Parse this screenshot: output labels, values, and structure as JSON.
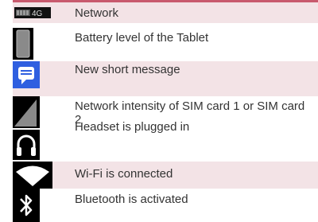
{
  "rows": [
    {
      "icon": "network-4g-icon",
      "description": "Network"
    },
    {
      "icon": "battery-icon",
      "description": "Battery level of the Tablet"
    },
    {
      "icon": "message-icon",
      "description": "New short message"
    },
    {
      "icon": "signal-strength-icon",
      "description": "Network intensity of SIM card 1 or SIM card 2"
    },
    {
      "icon": "headset-icon",
      "description": "Headset is plugged in"
    },
    {
      "icon": "wifi-icon",
      "description": "Wi-Fi is connected"
    },
    {
      "icon": "bluetooth-icon",
      "description": "Bluetooth is activated"
    }
  ],
  "colors": {
    "accent_rule": "#c85a6e",
    "row_shade": "#f3e3e6",
    "message_blue": "#2f5fe0"
  }
}
